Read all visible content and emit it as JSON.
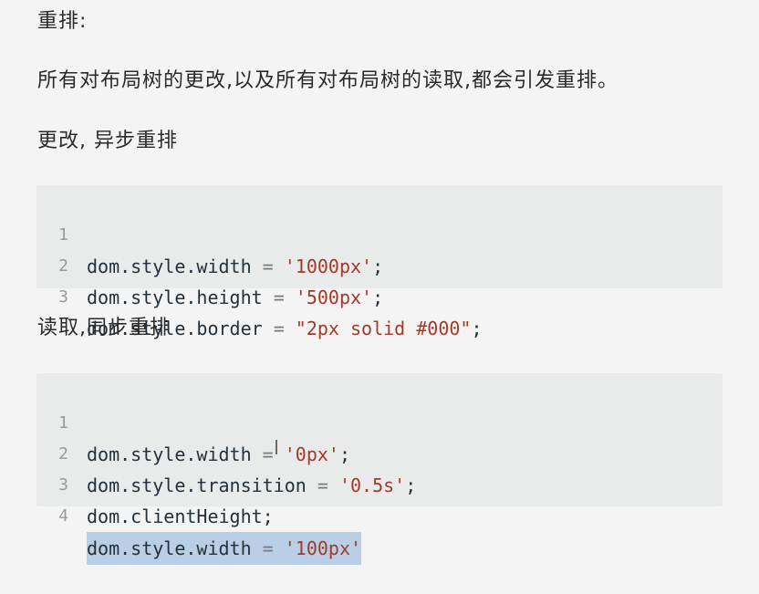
{
  "headings": {
    "reflow": "重排:",
    "description": "所有对布局树的更改,以及所有对布局树的读取,都会引发重排。",
    "change": "更改, 异步重排",
    "read": "读取,同步重排"
  },
  "code_block_1": [
    {
      "num": "1",
      "code": "dom.style.width = '1000px';"
    },
    {
      "num": "2",
      "code": "dom.style.height = '500px';"
    },
    {
      "num": "3",
      "code": "dom.style.border = \"2px solid #000\";"
    }
  ],
  "code_block_2": [
    {
      "num": "1",
      "code": "dom.style.width = '0px';"
    },
    {
      "num": "2",
      "code": "dom.style.transition = '0.5s';"
    },
    {
      "num": "3",
      "code": "dom.clientHeight;"
    },
    {
      "num": "4",
      "code": "dom.style.width = '100px'"
    }
  ],
  "colors": {
    "background": "#f3f4f3",
    "code_background": "#e9ebea",
    "string": "#a03a2a",
    "selection": "#b9cfe6"
  }
}
